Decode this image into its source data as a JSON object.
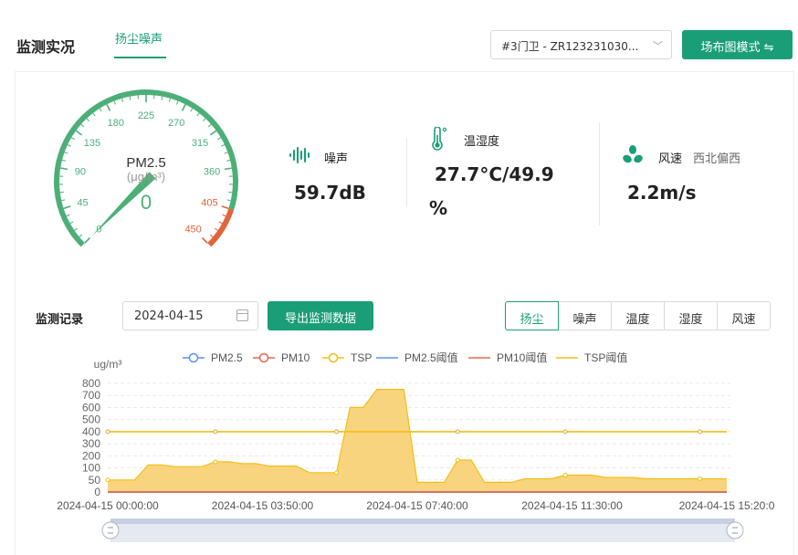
{
  "header": {
    "title": "监测实况",
    "tab_active": "扬尘噪声",
    "device": "#3门卫 - ZR123231030...",
    "layout_button": "场布图模式 ⇋"
  },
  "gauge": {
    "name": "PM2.5",
    "unit": "(μg/m³)",
    "value": 0,
    "value_text": "0",
    "min": 0,
    "max": 450,
    "warn_from": 405,
    "ticks": [
      "0",
      "45",
      "90",
      "135",
      "180",
      "225",
      "270",
      "315",
      "360",
      "405",
      "450"
    ],
    "colors": {
      "normal": "#4caf78",
      "warn": "#e0643c"
    }
  },
  "stats": {
    "noise": {
      "icon": "sound-wave-icon",
      "label": "噪声",
      "value": "59.7dB"
    },
    "temp_humidity": {
      "icon": "thermometer-icon",
      "label": "温湿度",
      "value_line1": "27.7°C/49.9",
      "value_line2": "%"
    },
    "wind": {
      "icon": "fan-icon",
      "label": "风速",
      "direction": "西北偏西",
      "value": "2.2m/s"
    }
  },
  "records": {
    "label": "监测记录",
    "date": "2024-04-15",
    "export_button": "导出监测数据",
    "tabs": [
      "扬尘",
      "噪声",
      "温度",
      "湿度",
      "风速"
    ],
    "active_tab": 0
  },
  "chart_data": {
    "type": "line",
    "unit_label": "ug/m³",
    "ylim": [
      0,
      800
    ],
    "yticks": [
      "0",
      "50",
      "100",
      "200",
      "300",
      "400",
      "500",
      "600",
      "700",
      "800"
    ],
    "ytick_values": [
      0,
      50,
      100,
      200,
      300,
      400,
      500,
      600,
      700,
      800
    ],
    "xtick_labels": [
      "2024-04-15 00:00:00",
      "2024-04-15 03:50:00",
      "2024-04-15 07:40:00",
      "2024-04-15 11:30:00",
      "2024-04-15 15:20:0"
    ],
    "x_minutes": [
      0,
      20,
      40,
      60,
      80,
      100,
      120,
      140,
      160,
      180,
      200,
      220,
      240,
      260,
      280,
      300,
      320,
      340,
      360,
      380,
      400,
      420,
      440,
      460,
      480,
      500,
      520,
      540,
      560,
      580,
      600,
      620,
      640,
      660,
      680,
      700,
      720,
      740,
      760,
      780,
      800,
      820,
      840,
      860,
      880,
      900,
      920
    ],
    "legend": [
      "PM2.5",
      "PM10",
      "TSP",
      "PM2.5阈值",
      "PM10阈值",
      "TSP阈值"
    ],
    "series": [
      {
        "name": "PM2.5",
        "color": "#5b8ff9",
        "values": [
          0,
          0,
          0,
          0,
          0,
          0,
          0,
          0,
          0,
          0,
          0,
          0,
          0,
          0,
          0,
          0,
          0,
          0,
          0,
          0,
          0,
          0,
          0,
          0,
          0,
          0,
          0,
          0,
          0,
          0,
          0,
          0,
          0,
          0,
          0,
          0,
          0,
          0,
          0,
          0,
          0,
          0,
          0,
          0,
          0,
          0,
          0
        ]
      },
      {
        "name": "PM10",
        "color": "#e8684a",
        "values": [
          0,
          0,
          0,
          0,
          0,
          0,
          0,
          0,
          0,
          0,
          0,
          0,
          0,
          0,
          0,
          0,
          0,
          0,
          0,
          0,
          0,
          0,
          0,
          0,
          0,
          0,
          0,
          0,
          0,
          0,
          0,
          0,
          0,
          0,
          0,
          0,
          0,
          0,
          0,
          0,
          0,
          0,
          0,
          0,
          0,
          0,
          0
        ]
      },
      {
        "name": "TSP",
        "color": "#f6bd16",
        "fill": "#f9d277",
        "values": [
          50,
          50,
          50,
          125,
          125,
          110,
          110,
          110,
          150,
          150,
          135,
          135,
          115,
          115,
          115,
          80,
          80,
          80,
          600,
          600,
          750,
          750,
          750,
          40,
          40,
          40,
          165,
          165,
          40,
          40,
          40,
          55,
          55,
          55,
          70,
          70,
          70,
          60,
          60,
          60,
          55,
          55,
          55,
          55,
          55,
          55,
          55
        ]
      },
      {
        "name": "PM2.5阈值",
        "color": "#5b8ff9",
        "values": [
          0,
          0,
          0,
          0,
          0,
          0,
          0,
          0,
          0,
          0,
          0,
          0,
          0,
          0,
          0,
          0,
          0,
          0,
          0,
          0,
          0,
          0,
          0,
          0,
          0,
          0,
          0,
          0,
          0,
          0,
          0,
          0,
          0,
          0,
          0,
          0,
          0,
          0,
          0,
          0,
          0,
          0,
          0,
          0,
          0,
          0,
          0
        ]
      },
      {
        "name": "PM10阈值",
        "color": "#e8684a",
        "values": [
          0,
          0,
          0,
          0,
          0,
          0,
          0,
          0,
          0,
          0,
          0,
          0,
          0,
          0,
          0,
          0,
          0,
          0,
          0,
          0,
          0,
          0,
          0,
          0,
          0,
          0,
          0,
          0,
          0,
          0,
          0,
          0,
          0,
          0,
          0,
          0,
          0,
          0,
          0,
          0,
          0,
          0,
          0,
          0,
          0,
          0,
          0
        ]
      },
      {
        "name": "TSP阈值",
        "color": "#f6bd16",
        "values": [
          400,
          400,
          400,
          400,
          400,
          400,
          400,
          400,
          400,
          400,
          400,
          400,
          400,
          400,
          400,
          400,
          400,
          400,
          400,
          400,
          400,
          400,
          400,
          400,
          400,
          400,
          400,
          400,
          400,
          400,
          400,
          400,
          400,
          400,
          400,
          400,
          400,
          400,
          400,
          400,
          400,
          400,
          400,
          400,
          400,
          400,
          400
        ]
      }
    ]
  }
}
